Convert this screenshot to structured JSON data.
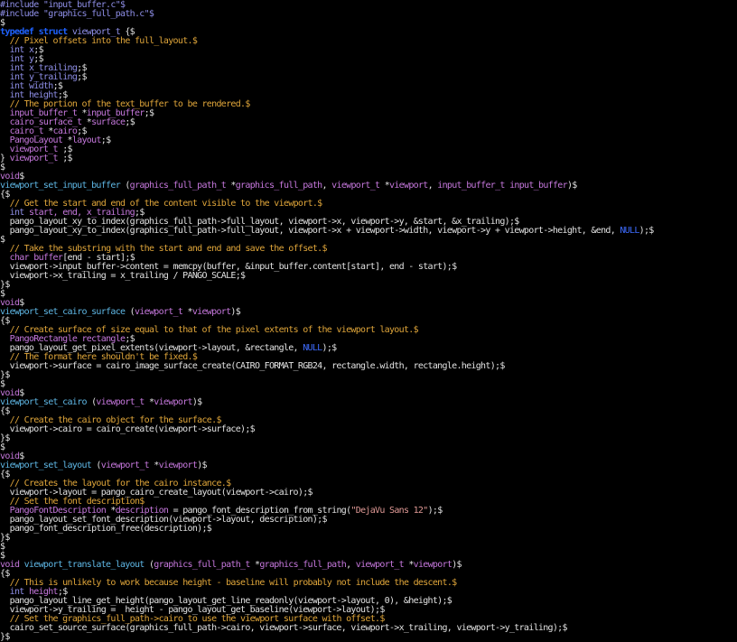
{
  "editor": {
    "lines": [
      [
        [
          "c1",
          "#include \"input_buffer.c\"$"
        ]
      ],
      [
        [
          "c1",
          "#include \"graphics_full_path.c\"$"
        ]
      ],
      [
        [
          "c0",
          "$"
        ]
      ],
      [
        [
          "c7 b",
          "typedef struct "
        ],
        [
          "c1",
          "viewport_t "
        ],
        [
          "c0",
          "{$"
        ]
      ],
      [
        [
          "c0",
          "  "
        ],
        [
          "c2",
          "// Pixel offsets into the full_layout.$"
        ]
      ],
      [
        [
          "c0",
          "  "
        ],
        [
          "c1",
          "int "
        ],
        [
          "c1",
          "x"
        ],
        [
          "c0",
          ";$"
        ]
      ],
      [
        [
          "c0",
          "  "
        ],
        [
          "c1",
          "int "
        ],
        [
          "c1",
          "y"
        ],
        [
          "c0",
          ";$"
        ]
      ],
      [
        [
          "c0",
          "  "
        ],
        [
          "c1",
          "int "
        ],
        [
          "c1",
          "x_trailing"
        ],
        [
          "c0",
          ";$"
        ]
      ],
      [
        [
          "c0",
          "  "
        ],
        [
          "c1",
          "int "
        ],
        [
          "c1",
          "y_trailing"
        ],
        [
          "c0",
          ";$"
        ]
      ],
      [
        [
          "c0",
          "  "
        ],
        [
          "c1",
          "int "
        ],
        [
          "c1",
          "width"
        ],
        [
          "c0",
          ";$"
        ]
      ],
      [
        [
          "c0",
          "  "
        ],
        [
          "c1",
          "int "
        ],
        [
          "c1",
          "height"
        ],
        [
          "c0",
          ";$"
        ]
      ],
      [
        [
          "c0",
          "  "
        ],
        [
          "c2",
          "// The portion of the text_buffer to be rendered.$"
        ]
      ],
      [
        [
          "c0",
          "  "
        ],
        [
          "c4",
          "input_buffer_t "
        ],
        [
          "c0",
          "*"
        ],
        [
          "c4",
          "input_buffer"
        ],
        [
          "c0",
          ";$"
        ]
      ],
      [
        [
          "c0",
          "  "
        ],
        [
          "c4",
          "cairo_surface_t "
        ],
        [
          "c0",
          "*"
        ],
        [
          "c4",
          "surface"
        ],
        [
          "c0",
          ";$"
        ]
      ],
      [
        [
          "c0",
          "  "
        ],
        [
          "c4",
          "cairo_t "
        ],
        [
          "c0",
          "*"
        ],
        [
          "c4",
          "cairo"
        ],
        [
          "c0",
          ";$"
        ]
      ],
      [
        [
          "c0",
          "  "
        ],
        [
          "c4",
          "PangoLayout "
        ],
        [
          "c0",
          "*"
        ],
        [
          "c4",
          "layout"
        ],
        [
          "c0",
          ";$"
        ]
      ],
      [
        [
          "c0",
          "  "
        ],
        [
          "c4",
          "viewport_t "
        ],
        [
          "c0",
          ";$"
        ]
      ],
      [
        [
          "c0",
          "} "
        ],
        [
          "c4",
          "viewport_t "
        ],
        [
          "c0",
          ";$"
        ]
      ],
      [
        [
          "c0",
          "$"
        ]
      ],
      [
        [
          "c4",
          "void"
        ],
        [
          "c0",
          "$"
        ]
      ],
      [
        [
          "c5",
          "viewport_set_input_buffer "
        ],
        [
          "c0",
          "("
        ],
        [
          "c4",
          "graphics_full_path_t "
        ],
        [
          "c0",
          "*"
        ],
        [
          "c4",
          "graphics_full_path"
        ],
        [
          "c0",
          ", "
        ],
        [
          "c4",
          "viewport_t "
        ],
        [
          "c0",
          "*"
        ],
        [
          "c4",
          "viewport"
        ],
        [
          "c0",
          ", "
        ],
        [
          "c4",
          "input_buffer_t "
        ],
        [
          "c4",
          "input_buffer"
        ],
        [
          "c0",
          ")$"
        ]
      ],
      [
        [
          "c0",
          "{$"
        ]
      ],
      [
        [
          "c0",
          "  "
        ],
        [
          "c2",
          "// Get the start and end of the content visible to the viewport.$"
        ]
      ],
      [
        [
          "c0",
          "  "
        ],
        [
          "c1",
          "int "
        ],
        [
          "c4",
          "start, end, x_trailing"
        ],
        [
          "c0",
          ";$"
        ]
      ],
      [
        [
          "c0",
          "  pango_layout_xy_to_index(graphics_full_path->full_layout, viewport->x, viewport->y, &start, &x_trailing);$"
        ]
      ],
      [
        [
          "c0",
          "  pango_layout_xy_to_index(graphics_full_path->full_layout, viewport->x + viewport->width, viewport->y + viewport->height, &end, "
        ],
        [
          "c6",
          "NULL"
        ],
        [
          "c0",
          ");$"
        ]
      ],
      [
        [
          "c0",
          "$"
        ]
      ],
      [
        [
          "c0",
          "  "
        ],
        [
          "c2",
          "// Take the substring with the start and end and save the offset.$"
        ]
      ],
      [
        [
          "c0",
          "  "
        ],
        [
          "c4",
          "char "
        ],
        [
          "c4",
          "buffer"
        ],
        [
          "c0",
          "[end - start];$"
        ]
      ],
      [
        [
          "c0",
          "  viewport->input_buffer->content = memcpy(buffer, &input_buffer.content[start], end - start);$"
        ]
      ],
      [
        [
          "c0",
          "  viewport->x_trailing = x_trailing / PANGO_SCALE;$"
        ]
      ],
      [
        [
          "c0",
          "}$"
        ]
      ],
      [
        [
          "c0",
          "$"
        ]
      ],
      [
        [
          "c4",
          "void"
        ],
        [
          "c0",
          "$"
        ]
      ],
      [
        [
          "c5",
          "viewport_set_cairo_surface "
        ],
        [
          "c0",
          "("
        ],
        [
          "c4",
          "viewport_t "
        ],
        [
          "c0",
          "*"
        ],
        [
          "c4",
          "viewport"
        ],
        [
          "c0",
          ")$"
        ]
      ],
      [
        [
          "c0",
          "{$"
        ]
      ],
      [
        [
          "c0",
          "  "
        ],
        [
          "c2",
          "// Create surface of size equal to that of the pixel extents of the viewport layout.$"
        ]
      ],
      [
        [
          "c0",
          "  "
        ],
        [
          "c4",
          "PangoRectangle "
        ],
        [
          "c4",
          "rectangle"
        ],
        [
          "c0",
          ";$"
        ]
      ],
      [
        [
          "c0",
          "  pango_layout_get_pixel_extents(viewport->layout, &rectangle, "
        ],
        [
          "c6",
          "NULL"
        ],
        [
          "c0",
          ");$"
        ]
      ],
      [
        [
          "c0",
          "  "
        ],
        [
          "c2",
          "// The format here shouldn't be fixed.$"
        ]
      ],
      [
        [
          "c0",
          "  viewport->surface = cairo_image_surface_create(CAIRO_FORMAT_RGB24, rectangle.width, rectangle.height);$"
        ]
      ],
      [
        [
          "c0",
          "}$"
        ]
      ],
      [
        [
          "c0",
          "$"
        ]
      ],
      [
        [
          "c4",
          "void"
        ],
        [
          "c0",
          "$"
        ]
      ],
      [
        [
          "c5",
          "viewport_set_cairo "
        ],
        [
          "c0",
          "("
        ],
        [
          "c4",
          "viewport_t "
        ],
        [
          "c0",
          "*"
        ],
        [
          "c4",
          "viewport"
        ],
        [
          "c0",
          ")$"
        ]
      ],
      [
        [
          "c0",
          "{$"
        ]
      ],
      [
        [
          "c0",
          "  "
        ],
        [
          "c2",
          "// Create the cairo object for the surface.$"
        ]
      ],
      [
        [
          "c0",
          "  viewport->cairo = cairo_create(viewport->surface);$"
        ]
      ],
      [
        [
          "c0",
          "}$"
        ]
      ],
      [
        [
          "c0",
          "$"
        ]
      ],
      [
        [
          "c4",
          "void"
        ],
        [
          "c0",
          "$"
        ]
      ],
      [
        [
          "c5",
          "viewport_set_layout "
        ],
        [
          "c0",
          "("
        ],
        [
          "c4",
          "viewport_t "
        ],
        [
          "c0",
          "*"
        ],
        [
          "c4",
          "viewport"
        ],
        [
          "c0",
          ")$"
        ]
      ],
      [
        [
          "c0",
          "{$"
        ]
      ],
      [
        [
          "c0",
          "  "
        ],
        [
          "c2",
          "// Creates the layout for the cairo instance.$"
        ]
      ],
      [
        [
          "c0",
          "  viewport->layout = pango_cairo_create_layout(viewport->cairo);$"
        ]
      ],
      [
        [
          "c0",
          "  "
        ],
        [
          "c2",
          "// Set the font description$"
        ]
      ],
      [
        [
          "c0",
          "  "
        ],
        [
          "c4",
          "PangoFontDescription "
        ],
        [
          "c0",
          "*"
        ],
        [
          "c4",
          "description"
        ],
        [
          "c0",
          " = pango_font_description_from_string("
        ],
        [
          "c3",
          "\"DejaVu Sans 12\""
        ],
        [
          "c0",
          ");$"
        ]
      ],
      [
        [
          "c0",
          "  pango_layout_set_font_description(viewport->layout, description);$"
        ]
      ],
      [
        [
          "c0",
          "  pango_font_description_free(description);$"
        ]
      ],
      [
        [
          "c0",
          "}$"
        ]
      ],
      [
        [
          "c0",
          "$"
        ]
      ],
      [
        [
          "c0",
          "$"
        ]
      ],
      [
        [
          "c4",
          "void "
        ],
        [
          "c5",
          "viewport_translate_layout "
        ],
        [
          "c0",
          "("
        ],
        [
          "c4",
          "graphics_full_path_t "
        ],
        [
          "c0",
          "*"
        ],
        [
          "c4",
          "graphics_full_path"
        ],
        [
          "c0",
          ", "
        ],
        [
          "c4",
          "viewport_t "
        ],
        [
          "c0",
          "*"
        ],
        [
          "c4",
          "viewport"
        ],
        [
          "c0",
          ")$"
        ]
      ],
      [
        [
          "c0",
          "{$"
        ]
      ],
      [
        [
          "c0",
          "  "
        ],
        [
          "c2",
          "// This is unlikely to work because height - baseline will probably not include the descent.$"
        ]
      ],
      [
        [
          "c0",
          "  "
        ],
        [
          "c1",
          "int "
        ],
        [
          "c4",
          "height"
        ],
        [
          "c0",
          ";$"
        ]
      ],
      [
        [
          "c0",
          "  pango_layout_line_get_height(pango_layout_get_line_readonly(viewport->layout, 0), &height);$"
        ]
      ],
      [
        [
          "c0",
          "  viewport->y_trailing =  height - pango_layout_get_baseline(viewport->layout);$"
        ]
      ],
      [
        [
          "c0",
          "  "
        ],
        [
          "c2",
          "// Set the graphics_full_path->cairo to use the viewport surface with offset.$"
        ]
      ],
      [
        [
          "c0",
          "  cairo_set_source_surface(graphics_full_path->cairo, viewport->surface, viewport->x_trailing, viewport->y_trailing);$"
        ]
      ],
      [
        [
          "c0",
          "}$"
        ]
      ]
    ]
  }
}
